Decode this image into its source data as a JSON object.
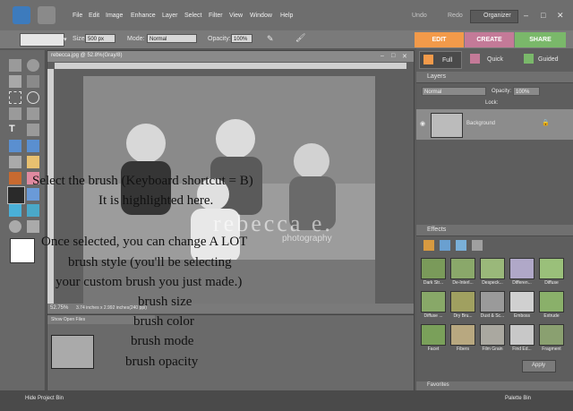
{
  "menubar": {
    "items": [
      "File",
      "Edit",
      "Image",
      "Enhance",
      "Layer",
      "Select",
      "Filter",
      "View",
      "Window",
      "Help"
    ],
    "undo": "Undo",
    "redo": "Redo",
    "organizer": "Organizer"
  },
  "options": {
    "size_label": "Size:",
    "size_value": "500 px",
    "mode_label": "Mode:",
    "mode_value": "Normal",
    "opacity_label": "Opacity:",
    "opacity_value": "100%"
  },
  "tabs": {
    "edit": "EDIT",
    "create": "CREATE",
    "share": "SHARE"
  },
  "edit_modes": {
    "full": "Full",
    "quick": "Quick",
    "guided": "Guided"
  },
  "document": {
    "title": "rebecca.jpg @ 52.8%(Gray/8)",
    "zoom": "52.75%",
    "dimensions": "3.74 inches x 2.992 inches(240 ppi)",
    "watermark": "rebecca e.",
    "watermark2": "photography"
  },
  "project_bin": {
    "show": "Show Open Files",
    "hide": "Hide Project Bin"
  },
  "layers": {
    "title": "Layers",
    "blend": "Normal",
    "opacity_label": "Opacity:",
    "opacity_value": "100%",
    "lock_label": "Lock:",
    "layer_name": "Background"
  },
  "effects": {
    "title": "Effects",
    "thumbs": [
      "Dark Str...",
      "De-Interl...",
      "Despeck...",
      "Differen...",
      "Diffuse",
      "Diffuse ...",
      "Dry Bru...",
      "Dust & Sc...",
      "Emboss",
      "Extrude",
      "Facet",
      "Fibers",
      "Film Grain",
      "Find Ed...",
      "Fragment"
    ],
    "apply": "Apply"
  },
  "lower_panel": {
    "title": "Favorites"
  },
  "palette_bin": "Palette Bin",
  "overlay": {
    "line1": "Select the brush (Keyboard shortcut = B)",
    "line2": "It is highlighted here.",
    "line3": "Once selected, you can change A LOT",
    "line4": "brush style (you'll be selecting",
    "line5": "your custom brush you just made.)",
    "line6": "brush size",
    "line7": "brush color",
    "line8": "brush mode",
    "line9": "brush opacity"
  },
  "colors": {
    "edit_tab": "#f29a4a",
    "create_tab": "#c47a98",
    "share_tab": "#7ab86a",
    "app_bg": "#5a5a5a"
  }
}
